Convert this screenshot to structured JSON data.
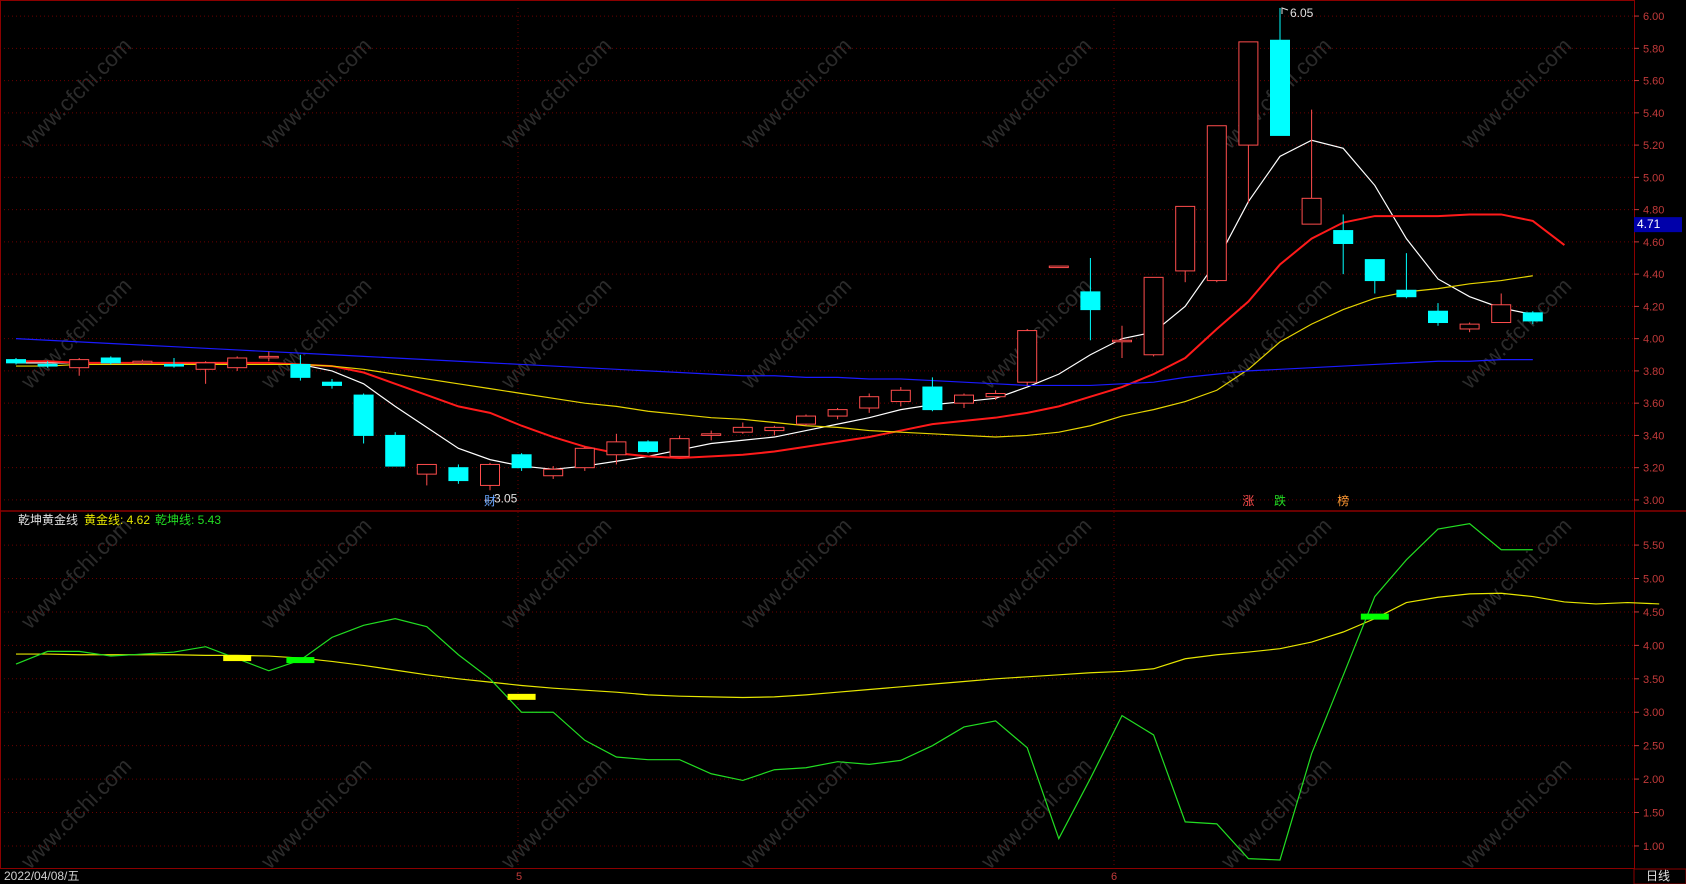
{
  "colors": {
    "background": "#000000",
    "frame": "#8b0000",
    "grid": "#6b0000",
    "axis_text": "#c23a3a",
    "up_candle": "#ff4d4d",
    "down_candle": "#00ffff",
    "ma5": "#ffffff",
    "ma10": "#ff1a1a",
    "ma20": "#e6d400",
    "ma60": "#1a1aff",
    "gold_line": "#e6e600",
    "qiankun_line": "#22dd22",
    "buy_marker": "#ffff00",
    "sell_marker": "#00ff00",
    "price_tag_bg": "#0000aa"
  },
  "watermark": "www.cfchi.com",
  "indicator": {
    "name": "乾坤黄金线",
    "gold_label": "黄金线: 4.62",
    "qiankun_label": "乾坤线: 5.43"
  },
  "footer": {
    "date": "2022/04/08/五",
    "period": "日线",
    "month_markers": [
      "5",
      "6"
    ]
  },
  "price_panel": {
    "current_price_tag": "4.71",
    "high_annotation": "6.05",
    "low_annotation": "←3.05",
    "event_labels": [
      {
        "text": "财",
        "index": 15,
        "color": "#6aa6ff"
      },
      {
        "text": "涨",
        "index": 39,
        "color": "#ff4d4d"
      },
      {
        "text": "跌",
        "index": 40,
        "color": "#22dd22"
      },
      {
        "text": "榜",
        "index": 42,
        "color": "#ff9933"
      }
    ]
  },
  "chart_data": [
    {
      "type": "candlestick",
      "title": "",
      "y_ticks": [
        "3.00",
        "3.20",
        "3.40",
        "3.60",
        "3.80",
        "4.00",
        "4.20",
        "4.40",
        "4.60",
        "4.80",
        "5.00",
        "5.20",
        "5.40",
        "5.60",
        "5.80",
        "6.00"
      ],
      "ylim": [
        2.95,
        6.05
      ],
      "candles": [
        {
          "o": 3.87,
          "h": 3.88,
          "l": 3.84,
          "c": 3.85
        },
        {
          "o": 3.84,
          "h": 3.86,
          "l": 3.82,
          "c": 3.83
        },
        {
          "o": 3.82,
          "h": 3.88,
          "l": 3.77,
          "c": 3.87
        },
        {
          "o": 3.88,
          "h": 3.89,
          "l": 3.84,
          "c": 3.85
        },
        {
          "o": 3.85,
          "h": 3.87,
          "l": 3.84,
          "c": 3.86
        },
        {
          "o": 3.84,
          "h": 3.88,
          "l": 3.82,
          "c": 3.83
        },
        {
          "o": 3.81,
          "h": 3.86,
          "l": 3.72,
          "c": 3.85
        },
        {
          "o": 3.82,
          "h": 3.89,
          "l": 3.8,
          "c": 3.88
        },
        {
          "o": 3.89,
          "h": 3.92,
          "l": 3.86,
          "c": 3.89
        },
        {
          "o": 3.84,
          "h": 3.9,
          "l": 3.74,
          "c": 3.76
        },
        {
          "o": 3.73,
          "h": 3.75,
          "l": 3.69,
          "c": 3.71
        },
        {
          "o": 3.65,
          "h": 3.66,
          "l": 3.35,
          "c": 3.4
        },
        {
          "o": 3.4,
          "h": 3.42,
          "l": 3.21,
          "c": 3.21
        },
        {
          "o": 3.16,
          "h": 3.22,
          "l": 3.09,
          "c": 3.22
        },
        {
          "o": 3.2,
          "h": 3.22,
          "l": 3.1,
          "c": 3.12
        },
        {
          "o": 3.09,
          "h": 3.23,
          "l": 3.06,
          "c": 3.22
        },
        {
          "o": 3.28,
          "h": 3.29,
          "l": 3.18,
          "c": 3.2
        },
        {
          "o": 3.15,
          "h": 3.21,
          "l": 3.13,
          "c": 3.19
        },
        {
          "o": 3.2,
          "h": 3.33,
          "l": 3.18,
          "c": 3.32
        },
        {
          "o": 3.28,
          "h": 3.41,
          "l": 3.22,
          "c": 3.36
        },
        {
          "o": 3.36,
          "h": 3.37,
          "l": 3.29,
          "c": 3.3
        },
        {
          "o": 3.27,
          "h": 3.4,
          "l": 3.27,
          "c": 3.38
        },
        {
          "o": 3.4,
          "h": 3.43,
          "l": 3.37,
          "c": 3.41
        },
        {
          "o": 3.42,
          "h": 3.48,
          "l": 3.41,
          "c": 3.45
        },
        {
          "o": 3.43,
          "h": 3.46,
          "l": 3.4,
          "c": 3.45
        },
        {
          "o": 3.47,
          "h": 3.53,
          "l": 3.46,
          "c": 3.52
        },
        {
          "o": 3.52,
          "h": 3.57,
          "l": 3.5,
          "c": 3.56
        },
        {
          "o": 3.57,
          "h": 3.66,
          "l": 3.54,
          "c": 3.64
        },
        {
          "o": 3.61,
          "h": 3.7,
          "l": 3.58,
          "c": 3.68
        },
        {
          "o": 3.7,
          "h": 3.76,
          "l": 3.55,
          "c": 3.56
        },
        {
          "o": 3.6,
          "h": 3.66,
          "l": 3.57,
          "c": 3.65
        },
        {
          "o": 3.64,
          "h": 3.68,
          "l": 3.62,
          "c": 3.66
        },
        {
          "o": 3.73,
          "h": 4.06,
          "l": 3.71,
          "c": 4.05
        },
        {
          "o": 4.45,
          "h": 4.45,
          "l": 4.45,
          "c": 4.45
        },
        {
          "o": 4.29,
          "h": 4.5,
          "l": 3.99,
          "c": 4.18
        },
        {
          "o": 3.99,
          "h": 4.08,
          "l": 3.88,
          "c": 3.99
        },
        {
          "o": 3.9,
          "h": 4.38,
          "l": 3.89,
          "c": 4.38
        },
        {
          "o": 4.42,
          "h": 4.82,
          "l": 4.35,
          "c": 4.82
        },
        {
          "o": 4.36,
          "h": 5.32,
          "l": 4.35,
          "c": 5.32
        },
        {
          "o": 5.2,
          "h": 5.84,
          "l": 4.84,
          "c": 5.84
        },
        {
          "o": 5.85,
          "h": 6.05,
          "l": 5.26,
          "c": 5.26
        },
        {
          "o": 4.71,
          "h": 5.42,
          "l": 4.71,
          "c": 4.87
        },
        {
          "o": 4.67,
          "h": 4.77,
          "l": 4.4,
          "c": 4.59
        },
        {
          "o": 4.49,
          "h": 4.49,
          "l": 4.28,
          "c": 4.36
        },
        {
          "o": 4.3,
          "h": 4.53,
          "l": 4.25,
          "c": 4.26
        },
        {
          "o": 4.17,
          "h": 4.22,
          "l": 4.08,
          "c": 4.1
        },
        {
          "o": 4.06,
          "h": 4.1,
          "l": 4.04,
          "c": 4.09
        },
        {
          "o": 4.1,
          "h": 4.28,
          "l": 4.1,
          "c": 4.21
        },
        {
          "o": 4.16,
          "h": 4.17,
          "l": 4.09,
          "c": 4.11
        }
      ],
      "series": [
        {
          "name": "",
          "color_key": "ma5",
          "values": [
            3.85,
            3.85,
            3.85,
            3.85,
            3.85,
            3.85,
            3.84,
            3.85,
            3.85,
            3.84,
            3.8,
            3.72,
            3.58,
            3.45,
            3.32,
            3.25,
            3.21,
            3.19,
            3.21,
            3.24,
            3.27,
            3.31,
            3.35,
            3.37,
            3.39,
            3.43,
            3.47,
            3.51,
            3.56,
            3.59,
            3.61,
            3.63,
            3.7,
            3.78,
            3.9,
            4.0,
            4.04,
            4.2,
            4.48,
            4.85,
            5.13,
            5.23,
            5.18,
            4.95,
            4.62,
            4.37,
            4.26,
            4.19,
            4.15
          ]
        },
        {
          "name": "",
          "color_key": "ma10",
          "values": [
            3.86,
            3.86,
            3.85,
            3.85,
            3.85,
            3.85,
            3.85,
            3.85,
            3.85,
            3.84,
            3.83,
            3.79,
            3.72,
            3.65,
            3.58,
            3.54,
            3.46,
            3.39,
            3.33,
            3.29,
            3.27,
            3.26,
            3.27,
            3.28,
            3.3,
            3.33,
            3.36,
            3.39,
            3.43,
            3.47,
            3.49,
            3.51,
            3.54,
            3.58,
            3.64,
            3.7,
            3.78,
            3.88,
            4.06,
            4.23,
            4.46,
            4.62,
            4.72,
            4.76,
            4.76,
            4.76,
            4.77,
            4.77,
            4.73,
            4.58
          ]
        },
        {
          "name": "",
          "color_key": "ma20",
          "values": [
            3.83,
            3.83,
            3.84,
            3.84,
            3.84,
            3.84,
            3.84,
            3.84,
            3.84,
            3.84,
            3.83,
            3.81,
            3.78,
            3.75,
            3.72,
            3.69,
            3.66,
            3.63,
            3.6,
            3.58,
            3.55,
            3.53,
            3.51,
            3.5,
            3.48,
            3.46,
            3.45,
            3.43,
            3.42,
            3.41,
            3.4,
            3.39,
            3.4,
            3.42,
            3.46,
            3.52,
            3.56,
            3.61,
            3.68,
            3.81,
            3.98,
            4.09,
            4.18,
            4.25,
            4.29,
            4.31,
            4.34,
            4.36,
            4.39
          ]
        },
        {
          "name": "",
          "color_key": "ma60",
          "values": [
            4.0,
            3.99,
            3.98,
            3.97,
            3.96,
            3.95,
            3.94,
            3.93,
            3.92,
            3.91,
            3.9,
            3.89,
            3.88,
            3.87,
            3.86,
            3.85,
            3.84,
            3.83,
            3.82,
            3.81,
            3.8,
            3.79,
            3.78,
            3.77,
            3.77,
            3.76,
            3.76,
            3.75,
            3.75,
            3.74,
            3.73,
            3.72,
            3.71,
            3.71,
            3.71,
            3.72,
            3.73,
            3.76,
            3.78,
            3.8,
            3.81,
            3.82,
            3.83,
            3.84,
            3.85,
            3.86,
            3.86,
            3.87,
            3.87
          ]
        }
      ]
    },
    {
      "type": "line",
      "title": "乾坤黄金线",
      "y_ticks": [
        "1.00",
        "1.50",
        "2.00",
        "2.50",
        "3.00",
        "3.50",
        "4.00",
        "4.50",
        "5.00",
        "5.50"
      ],
      "ylim": [
        0.7,
        5.98
      ],
      "series": [
        {
          "name": "黄金线",
          "color_key": "gold_line",
          "values": [
            3.87,
            3.87,
            3.86,
            3.86,
            3.86,
            3.86,
            3.85,
            3.85,
            3.84,
            3.81,
            3.76,
            3.7,
            3.63,
            3.56,
            3.5,
            3.45,
            3.4,
            3.36,
            3.33,
            3.3,
            3.26,
            3.24,
            3.23,
            3.22,
            3.23,
            3.26,
            3.3,
            3.34,
            3.38,
            3.42,
            3.46,
            3.5,
            3.53,
            3.56,
            3.59,
            3.61,
            3.65,
            3.8,
            3.86,
            3.9,
            3.95,
            4.05,
            4.2,
            4.4,
            4.64,
            4.72,
            4.77,
            4.78,
            4.73,
            4.65,
            4.62,
            4.64,
            4.62
          ]
        },
        {
          "name": "乾坤线",
          "color_key": "qiankun_line",
          "values": [
            3.72,
            3.91,
            3.91,
            3.84,
            3.87,
            3.9,
            3.98,
            3.8,
            3.62,
            3.78,
            4.12,
            4.3,
            4.4,
            4.28,
            3.86,
            3.5,
            3.0,
            3.0,
            2.58,
            2.33,
            2.29,
            2.29,
            2.08,
            1.98,
            2.14,
            2.17,
            2.26,
            2.22,
            2.28,
            2.5,
            2.78,
            2.87,
            2.47,
            1.11,
            2.01,
            2.95,
            2.66,
            1.36,
            1.33,
            0.81,
            0.79,
            2.38,
            3.55,
            4.73,
            5.28,
            5.74,
            5.82,
            5.43,
            5.43
          ]
        }
      ],
      "markers": [
        {
          "index": 7,
          "value": 3.81,
          "color_key": "buy_marker"
        },
        {
          "index": 9,
          "value": 3.78,
          "color_key": "sell_marker"
        },
        {
          "index": 16,
          "value": 3.23,
          "color_key": "buy_marker"
        },
        {
          "index": 43,
          "value": 4.43,
          "color_key": "sell_marker"
        }
      ]
    }
  ]
}
